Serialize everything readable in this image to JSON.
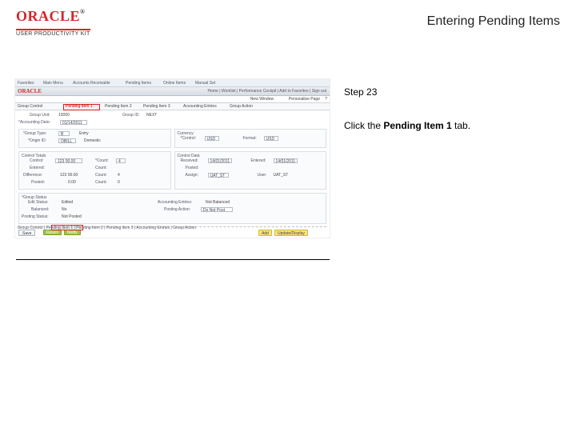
{
  "header": {
    "logo_main": "ORACLE",
    "logo_tm": "®",
    "logo_sub": "USER PRODUCTIVITY KIT",
    "title": "Entering Pending Items"
  },
  "right": {
    "step": "Step 23",
    "instr_pre": "Click the ",
    "instr_bold": "Pending Item 1",
    "instr_post": " tab."
  },
  "ss": {
    "menubar": {
      "favorites": "Favorites",
      "mainmenu": "Main Menu",
      "crumb1": "Accounts Receivable",
      "crumb2": "Pending Items",
      "crumb3": "Online Items",
      "crumb4": "Manual Set"
    },
    "banner": {
      "logo": "ORACLE",
      "links": "Home | Worklist | Performance Cockpit | Add to Favorites | Sign out"
    },
    "blueline": {
      "newwin": "New Window",
      "personal": "Personalize Page",
      "icon": "?"
    },
    "tabs": {
      "t1": "Group Control",
      "t2": "Pending Item 1",
      "t3": "Pending Item 2",
      "t4": "Pending Item 3",
      "t5": "Accounting Entries",
      "t6": "Group Action"
    },
    "group": {
      "unit_lbl": "Group Unit:",
      "unit": "10000",
      "id_lbl": "Group ID:",
      "id": "NEXT"
    },
    "acct": {
      "date_lbl": "*Accounting Date:",
      "date": "01/14/2011"
    },
    "left": {
      "grouptype_lbl": "*Group Type:",
      "grouptype": "B",
      "entry": "Entry",
      "origin_lbl": "*Origin ID:",
      "origin": "OBILL",
      "domestic": "Domestic"
    },
    "currency": {
      "title": "Currency",
      "ctl_lbl": "*Control:",
      "ctl": "USD",
      "fmt_lbl": "Format:",
      "fmt": "USD"
    },
    "totals": {
      "title_l": "Control Totals",
      "title_r": "Control Data",
      "control_lbl": "Control:",
      "control": "123 00.00",
      "ccount_lbl": "*Count:",
      "ccount": "4",
      "entered_lbl": "Entered:",
      "entered": "",
      "ecount_lbl": "Count:",
      "ecount": "",
      "diff_lbl": "Difference:",
      "diff": "123 00.00",
      "dcount_lbl": "Count:",
      "dcount": "4",
      "posted_lbl": "Posted:",
      "posted": "0.00",
      "pcount_lbl": "Count:",
      "pcount": "0",
      "recv_lbl": "Received:",
      "recv": "14/01/2011",
      "ent2_lbl": "Entered:",
      "ent2": "14/01/2011",
      "post2_lbl": "Posted:",
      "post2": "",
      "ass_lbl": "Assign:",
      "ass": "UAT_ST",
      "user_lbl": "User:",
      "user": "UAT_ST"
    },
    "status": {
      "title": "*Group Status",
      "edit_lbl": "Edit Status:",
      "edit": "Edited",
      "bal_lbl": "Balanced:",
      "bal": "No",
      "post_lbl": "Posting Status:",
      "post": "Not Posted",
      "aes_lbl": "Accounting Entries:",
      "aes": "Not Balanced",
      "act_lbl": "Posting Action:",
      "act": "Do Not Post"
    },
    "buttons": {
      "save": "Save",
      "return": "Return",
      "notify": "Notify",
      "add": "Add",
      "update": "Update/Display"
    },
    "footer": "Group Control | Pending Item 1 | Pending Item 2 | Pending Item 3 | Accounting Entries | Group Action"
  }
}
